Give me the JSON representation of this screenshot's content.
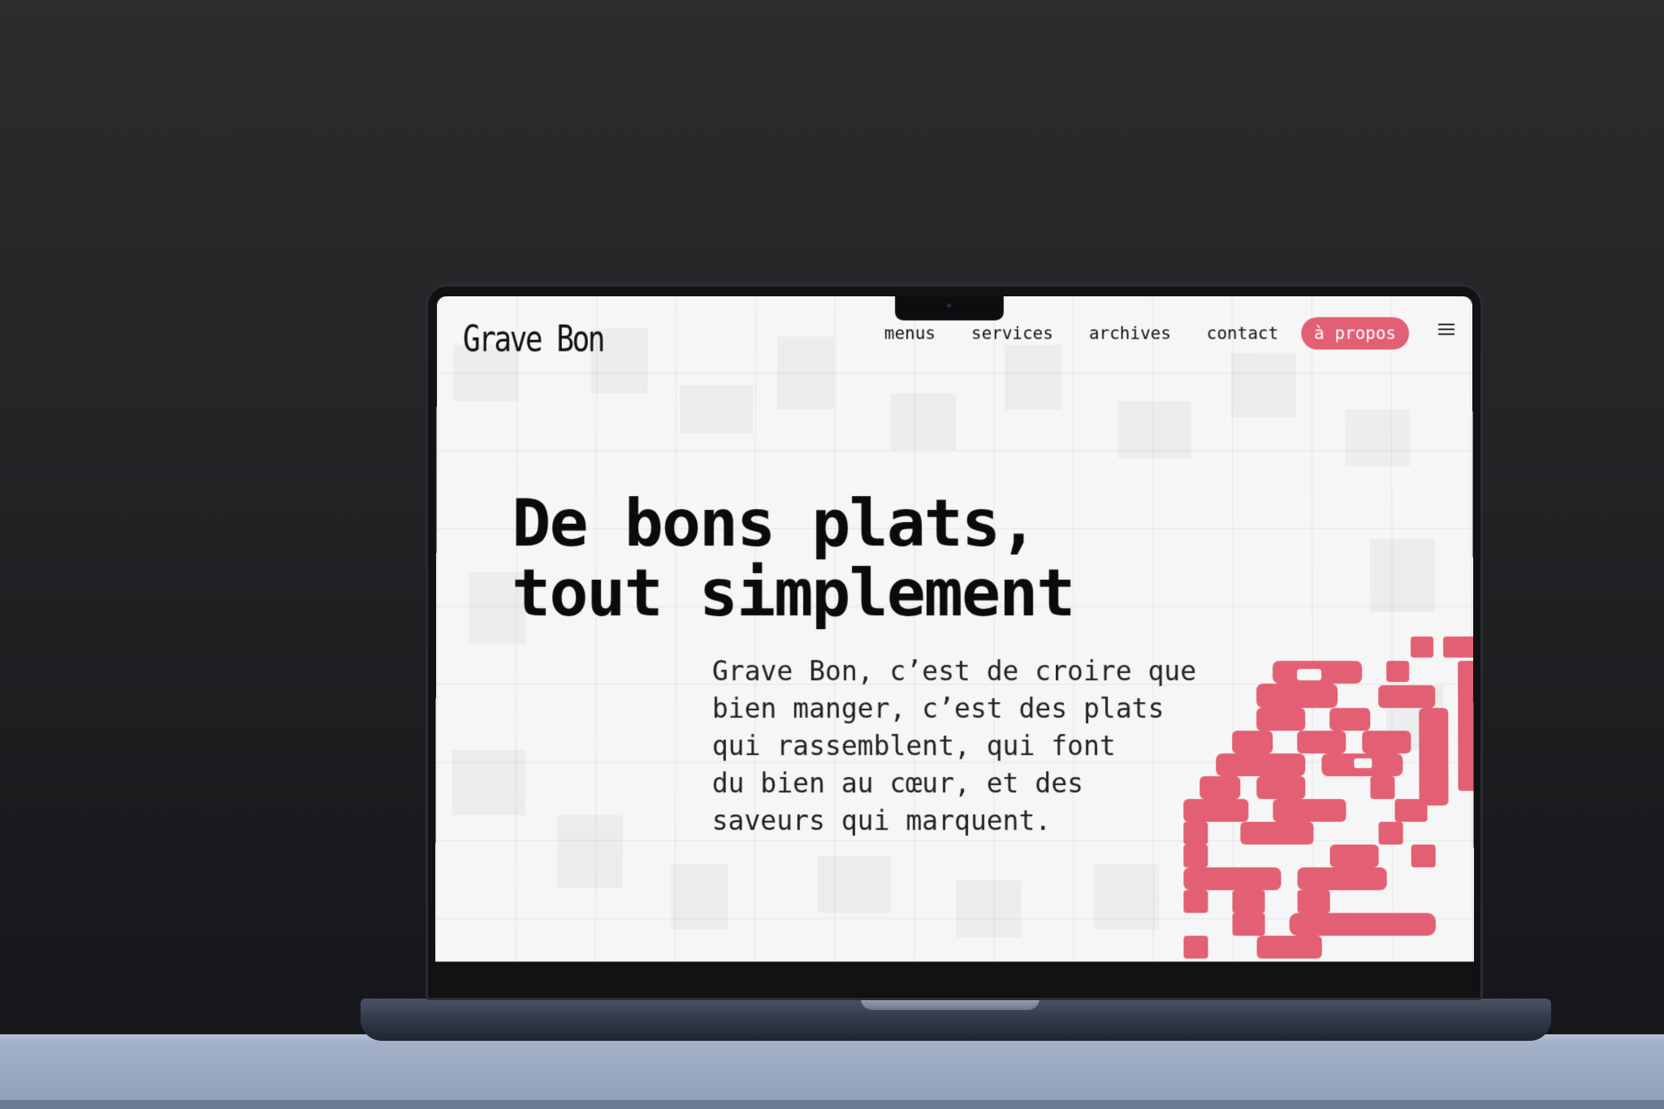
{
  "site": {
    "logo": "Grave Bon",
    "nav": [
      {
        "label": "menus"
      },
      {
        "label": "services"
      },
      {
        "label": "archives"
      },
      {
        "label": "contact"
      }
    ],
    "cta": "à propos",
    "menu_icon": "hamburger-icon"
  },
  "hero": {
    "headline_line1": "De bons plats,",
    "headline_line2": "tout simplement",
    "intro_lines": [
      "Grave Bon, c’est de croire que",
      "bien manger, c’est des plats",
      "qui rassemblent, qui font",
      "du bien au cœur, et des",
      "saveurs qui marquent."
    ]
  },
  "colors": {
    "accent": "#e35f73",
    "text": "#111111",
    "background": "#f6f6f6"
  }
}
